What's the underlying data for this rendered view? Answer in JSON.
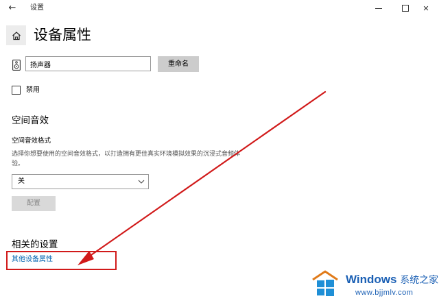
{
  "window": {
    "app_title": "设置",
    "back_icon": "arrow-left-icon",
    "controls": [
      "minimize-icon",
      "maximize-icon",
      "close-icon"
    ]
  },
  "page": {
    "title": "设备属性",
    "home_icon": "home-icon"
  },
  "device": {
    "icon": "speaker-icon",
    "name_value": "扬声器",
    "rename_label": "重命名"
  },
  "disable": {
    "label": "禁用",
    "checked": false
  },
  "spatial_audio": {
    "heading": "空间音效",
    "format_label": "空间音效格式",
    "description": "选择你想要使用的空间音效格式，以打造拥有更佳真实环境模拟效果的沉浸式音频体验。",
    "selected": "关",
    "configure_label": "配置"
  },
  "related": {
    "heading": "相关的设置",
    "link_label": "其他设备属性"
  },
  "annotation": {
    "color": "#d11a1a"
  },
  "watermark": {
    "brand_en": "Windows",
    "brand_cn": "系统之家",
    "url": "www.bjjmlv.com"
  },
  "colors": {
    "link": "#0063b1",
    "button_bg": "#cccccc",
    "disabled_button_bg": "#d9d9d9",
    "home_tile_bg": "#ececec"
  }
}
